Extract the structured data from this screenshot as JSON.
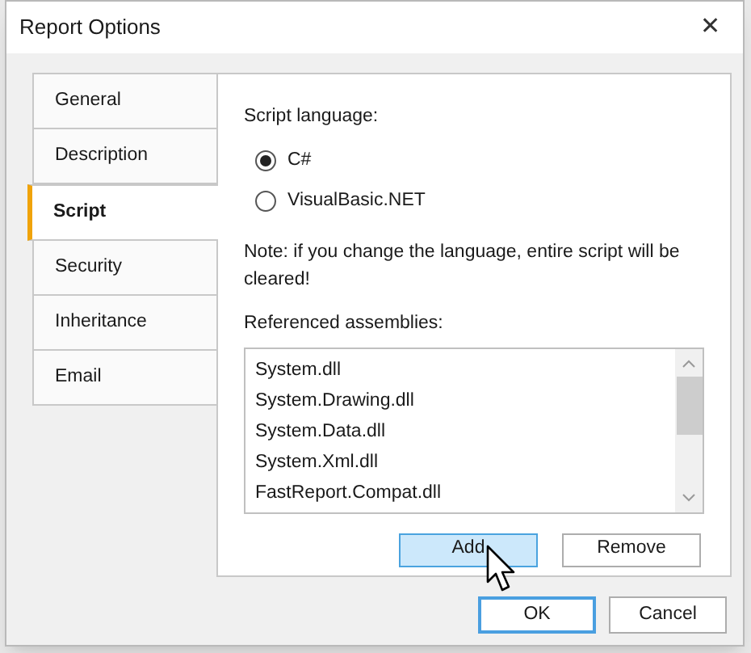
{
  "window": {
    "title": "Report Options",
    "close": "✕"
  },
  "tabs": [
    {
      "label": "General",
      "selected": false
    },
    {
      "label": "Description",
      "selected": false
    },
    {
      "label": "Script",
      "selected": true
    },
    {
      "label": "Security",
      "selected": false
    },
    {
      "label": "Inheritance",
      "selected": false
    },
    {
      "label": "Email",
      "selected": false
    }
  ],
  "script_language": {
    "label": "Script language:",
    "options": [
      {
        "label": "C#",
        "selected": true
      },
      {
        "label": "VisualBasic.NET",
        "selected": false
      }
    ]
  },
  "note": "Note: if you change the language, entire script will be cleared!",
  "assemblies": {
    "label": "Referenced assemblies:",
    "items": [
      "System.dll",
      "System.Drawing.dll",
      "System.Data.dll",
      "System.Xml.dll",
      "FastReport.Compat.dll"
    ],
    "buttons": [
      {
        "label": "Add",
        "hovered": true
      },
      {
        "label": "Remove",
        "hovered": false
      }
    ]
  },
  "buttons": [
    {
      "label": "OK",
      "default": true
    },
    {
      "label": "Cancel",
      "default": false
    }
  ]
}
